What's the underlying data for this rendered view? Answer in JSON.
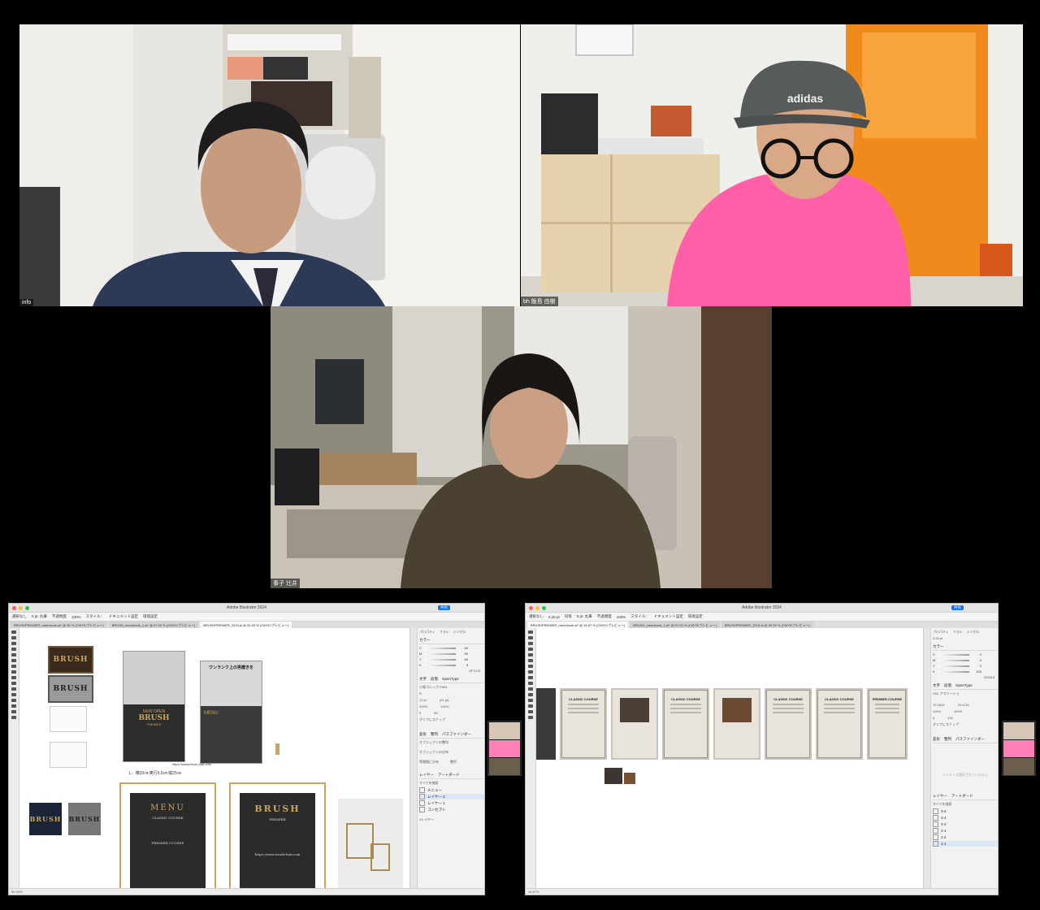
{
  "participants": [
    {
      "label": "info"
    },
    {
      "label": "bh 飯島 由樹"
    },
    {
      "label": "事子 辻井"
    }
  ],
  "ai_left": {
    "app_title": "Adobe Illustrator 2024",
    "share": "共有",
    "control_bar": {
      "selection": "選択なし",
      "stroke_pt": "5 pt. 丸筆",
      "opacity_label": "不透明度",
      "opacity": "100%",
      "style_label": "スタイル：",
      "doc_settings": "ドキュメント設定",
      "env_settings": "環境設定"
    },
    "tabs": [
      "BRUSHPREMIER_menubook.ai* @ 50 % (CMYK/プレビュー)",
      "BRUSH_menubook_1.ai* @ 67.02 % (CMYK/プレビュー)",
      "BRUSHPREMIER_2015.ai @ 50.33 % (CMYK/プレビュー)"
    ],
    "canvas": {
      "brush": "BRUSH",
      "premier": "PREMIER",
      "flyer_headline": "ワンランク上の男磨きを",
      "new_open": "NEW OPEN",
      "menu": "MENU",
      "url": "https://www.brush-hair.com",
      "size_note": "L：横20㎝ 奥行6.5㎝ 縦25㎝",
      "classic_course": "CLASSIC COURSE",
      "premier_course": "PREMIER COURSE"
    },
    "panel": {
      "tabs": [
        "プロパティ",
        "ブラシ",
        "シンボル"
      ],
      "color_label": "カラー",
      "cmyk": [
        {
          "k": "C",
          "v": "60"
        },
        {
          "k": "M",
          "v": "50"
        },
        {
          "k": "Y",
          "v": "60"
        },
        {
          "k": "K",
          "v": "5"
        }
      ],
      "hex": "6F7C4T",
      "char_tabs": [
        "文字",
        "段落",
        "OpenType"
      ],
      "font": "小塚ゴシック Pr6N",
      "font_style": "R",
      "font_size": "12 pt",
      "leading": "(21 pt)",
      "scale_h": "100%",
      "scale_v": "100%",
      "tracking": "0",
      "kerning": "50",
      "glyph_snap": "グリフにスナップ",
      "transform_tabs": [
        "変形",
        "整列",
        "パスファインダー"
      ],
      "align_objects": "オブジェクトの整列",
      "distribute_objects": "オブジェクトの分布",
      "distribute_spacing": "等間隔に分布",
      "align_to": "整列",
      "layers_tabs": [
        "レイヤー",
        "アートボード"
      ],
      "search": "すべてを検索",
      "layers": [
        "メニュー",
        "レイヤー 2",
        "レイヤー 1",
        "コンセプト"
      ],
      "layer_count": "4レイヤー"
    },
    "status": "50.33%"
  },
  "ai_right": {
    "app_title": "Adobe Illustrator 2024",
    "share": "共有",
    "control_bar": {
      "selection": "選択なし",
      "stroke_weight": "0.25 pt",
      "stroke_style": "均等",
      "brush": "5 pt. 丸筆",
      "opacity_label": "不透明度",
      "opacity": "100%",
      "style_label": "スタイル：",
      "doc_settings": "ドキュメント設定",
      "env_settings": "環境設定"
    },
    "tabs": [
      "BRUSHPREMIER_menubook.ai* @ 16.67 % (CMYK/プレビュー)",
      "BRUSH_menubook_1.ai* @ 67.02 % (CMYK/プレビュー)",
      "BRUSHPREMIER_2015.ai @ 50.33 % (CMYK/プレビュー)"
    ],
    "canvas": {
      "course_cards": [
        "CLASSIC COURSE",
        "CLASSIC COURSE",
        "CLASSIC COURSE",
        "CLASSIC COURSE",
        "PREMIER COURSE"
      ]
    },
    "panel": {
      "tabs": [
        "プロパティ",
        "ブラシ",
        "シンボル"
      ],
      "stroke": "0.25 pt",
      "color_label": "カラー",
      "cmyk": [
        {
          "k": "C",
          "v": "0"
        },
        {
          "k": "M",
          "v": "0"
        },
        {
          "k": "Y",
          "v": "0"
        },
        {
          "k": "K",
          "v": "100"
        }
      ],
      "hex": "231815",
      "char_tabs": [
        "文字",
        "段落",
        "OpenType"
      ],
      "font": "VDL アマミーショ",
      "font_size": "12.2813",
      "leading": "29.4751",
      "scale_h": "110%",
      "scale_v": "100%",
      "tracking": "0",
      "kerning": "100",
      "glyph_snap": "グリフにスナップ",
      "transform_tabs": [
        "変形",
        "整列",
        "パスファインダー"
      ],
      "empty_note": "レイヤーが選択されていません",
      "layers_tabs": [
        "レイヤー",
        "アートボード"
      ],
      "search": "すべてを検索",
      "layers": [
        "3-2",
        "3-1",
        "2-2",
        "2-1",
        "1-2",
        "1-1"
      ]
    },
    "status": "16.67%"
  },
  "colors": {
    "brush_brown": "#3a2a1c",
    "gold": "#c8a55a",
    "zoom_label_bg": "#000000",
    "adobe_blue": "#1473e6"
  }
}
